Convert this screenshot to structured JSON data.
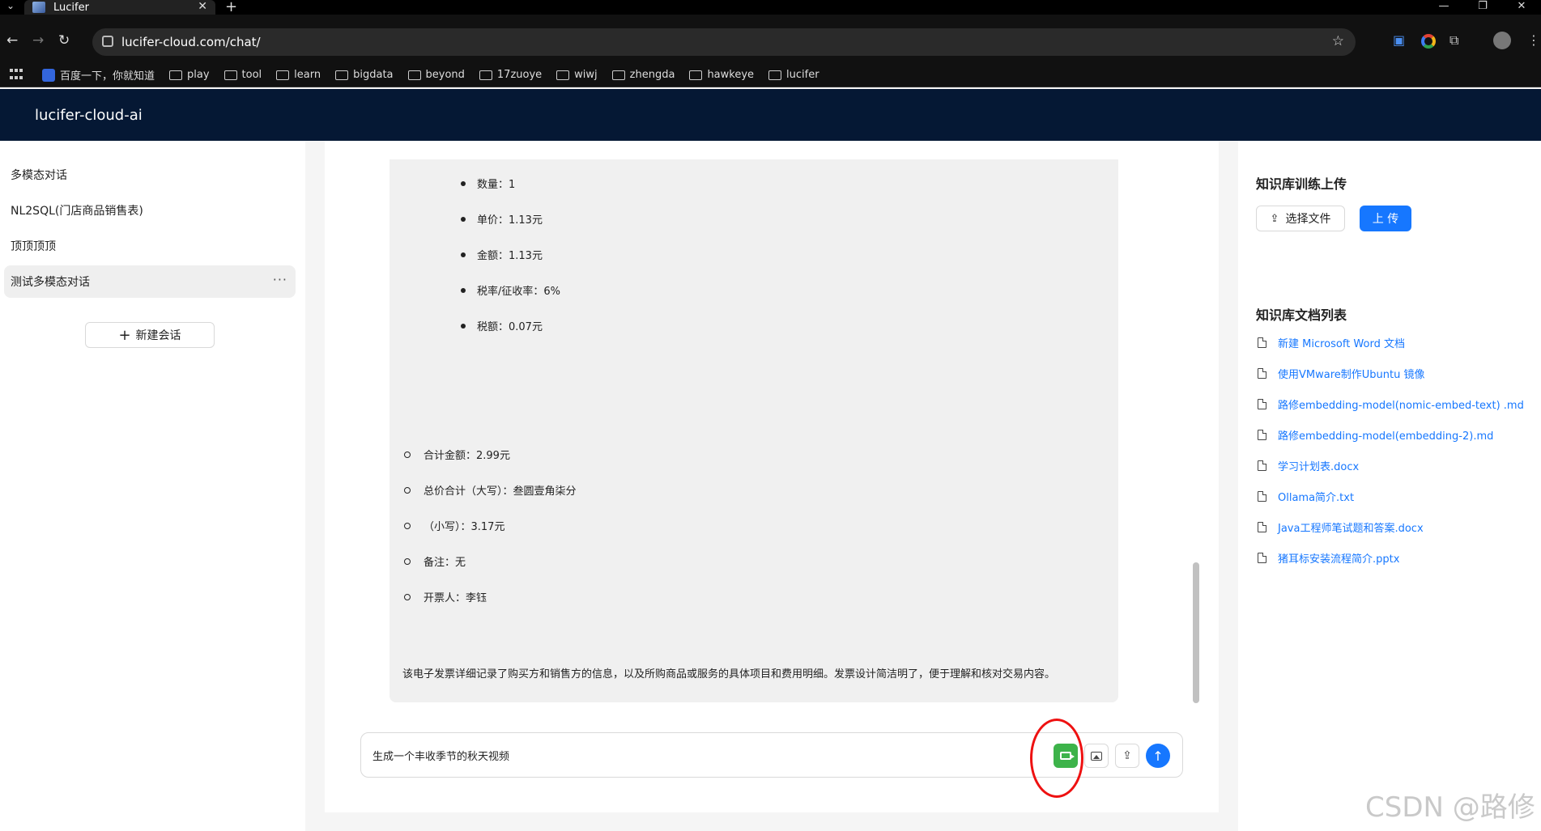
{
  "browser": {
    "tab_title": "Lucifer",
    "tab_close": "✕",
    "new_tab": "+",
    "url": "lucifer-cloud.com/chat/",
    "bookmarks": [
      "百度一下，你就知道",
      "play",
      "tool",
      "learn",
      "bigdata",
      "beyond",
      "17zuoye",
      "wiwj",
      "zhengda",
      "hawkeye",
      "lucifer"
    ]
  },
  "app": {
    "title": "lucifer-cloud-ai"
  },
  "sidebar": {
    "items": [
      {
        "label": "多模态对话"
      },
      {
        "label": "NL2SQL(门店商品销售表)"
      },
      {
        "label": "顶顶顶顶"
      },
      {
        "label": "测试多模态对话",
        "active": true,
        "more": "···"
      }
    ],
    "new_chat": "新建会话"
  },
  "message": {
    "items_level2": [
      "数量：1",
      "单价：1.13元",
      "金额：1.13元",
      "税率/征收率：6%",
      "税额：0.07元"
    ],
    "items_level1": [
      "合计金额：2.99元",
      "总价合计（大写）：叁圆壹角柒分",
      "（小写）：3.17元",
      "备注：无",
      "开票人：李钰"
    ],
    "summary": "该电子发票详细记录了购买方和销售方的信息，以及所购商品或服务的具体项目和费用明细。发票设计简洁明了，便于理解和核对交易内容。"
  },
  "composer": {
    "value": "生成一个丰收季节的秋天视频",
    "send_icon": "↑",
    "upload_icon": "⇪"
  },
  "knowledge": {
    "upload_title": "知识库训练上传",
    "pick_file": "选择文件",
    "upload": "上 传",
    "list_title": "知识库文档列表",
    "docs": [
      "新建 Microsoft Word 文档",
      "使用VMware制作Ubuntu 镜像",
      "路修embedding-model(nomic-embed-text) .md",
      "路修embedding-model(embedding-2).md",
      "学习计划表.docx",
      "Ollama简介.txt",
      "Java工程师笔试题和答案.docx",
      "猪耳标安装流程简介.pptx"
    ]
  },
  "watermark": "CSDN @路修"
}
